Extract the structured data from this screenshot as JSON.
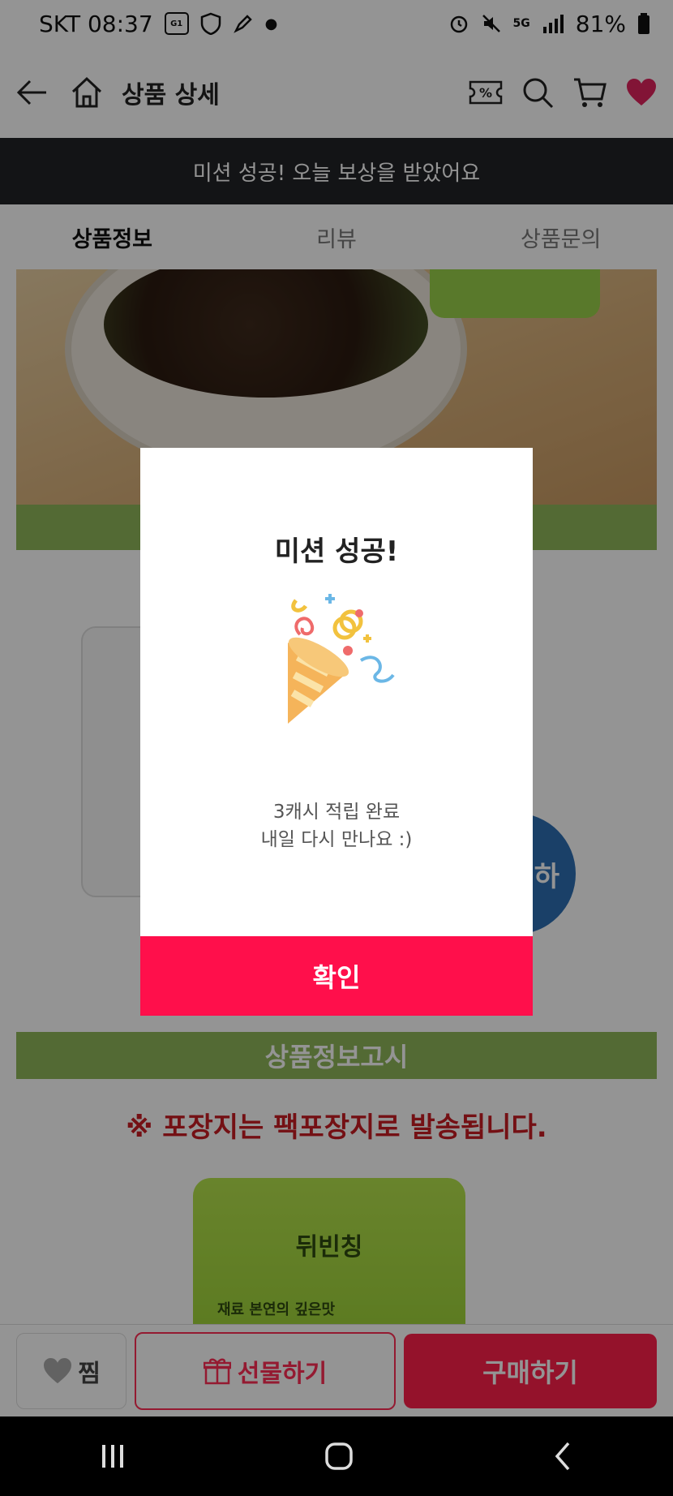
{
  "status_bar": {
    "carrier_time": "SKT 08:37",
    "network": "5G",
    "battery": "81%",
    "icons": [
      "g1-icon",
      "ssm-icon",
      "pen-icon",
      "alarm-icon",
      "mute-icon",
      "signal-icon",
      "battery-icon"
    ]
  },
  "header": {
    "title": "상품 상세",
    "badge_percent": "%"
  },
  "mission_banner": {
    "text": "미션 성공! 오늘 보상을 받았어요"
  },
  "tabs": [
    {
      "label": "상품정보",
      "active": true
    },
    {
      "label": "리뷰",
      "active": false
    },
    {
      "label": "상품문의",
      "active": false
    }
  ],
  "content": {
    "circle_text": "하",
    "section_heading": "상품정보고시",
    "notice_text": "※ 포장지는 팩포장지로 발송됩니다.",
    "pouch_brand": "뒤빈칭",
    "pouch_tag": "재료 본연의 깊은맛"
  },
  "bottom_bar": {
    "like_label": "찜",
    "gift_label": "선물하기",
    "buy_label": "구매하기"
  },
  "dialog": {
    "title": "미션 성공!",
    "message_line1": "3캐시 적립 완료",
    "message_line2": "내일 다시 만나요 :)",
    "confirm_label": "확인"
  },
  "colors": {
    "accent": "#ff0f4b",
    "banner_bg": "#222326",
    "band_green": "#8fb75a"
  }
}
